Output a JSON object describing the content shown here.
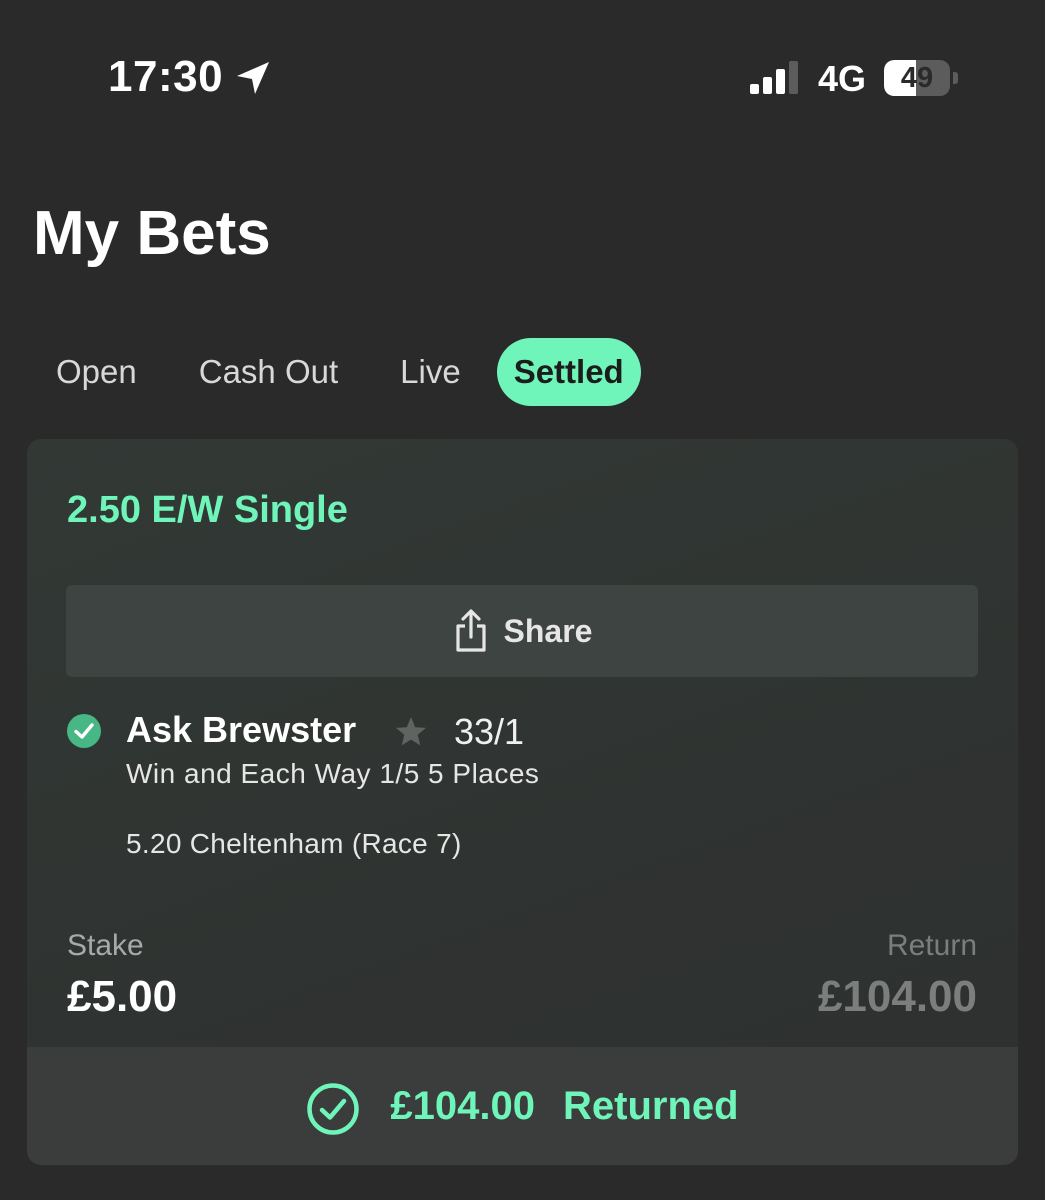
{
  "status_bar": {
    "time": "17:30",
    "network": "4G",
    "battery_level": "49",
    "battery_fraction": 0.49,
    "icons": [
      "location-arrow-icon",
      "signal-bars-icon",
      "battery-icon"
    ]
  },
  "page": {
    "title": "My Bets"
  },
  "tabs": [
    {
      "label": "Open",
      "active": false
    },
    {
      "label": "Cash Out",
      "active": false
    },
    {
      "label": "Live",
      "active": false
    },
    {
      "label": "Settled",
      "active": true
    }
  ],
  "bet": {
    "type": "2.50 E/W Single",
    "share_label": "Share",
    "selection": {
      "name": "Ask Brewster",
      "odds": "33/1",
      "market": "Win and Each Way 1/5 5 Places",
      "event": "5.20 Cheltenham (Race 7)"
    },
    "stake_label": "Stake",
    "stake_value": "£5.00",
    "return_label": "Return",
    "return_value": "£104.00",
    "returned_amount": "£104.00",
    "returned_label": "Returned"
  },
  "colors": {
    "background": "#2a2a2a",
    "accent": "#6ff5b9",
    "card": "#313633",
    "muted": "#7c7e7d"
  }
}
